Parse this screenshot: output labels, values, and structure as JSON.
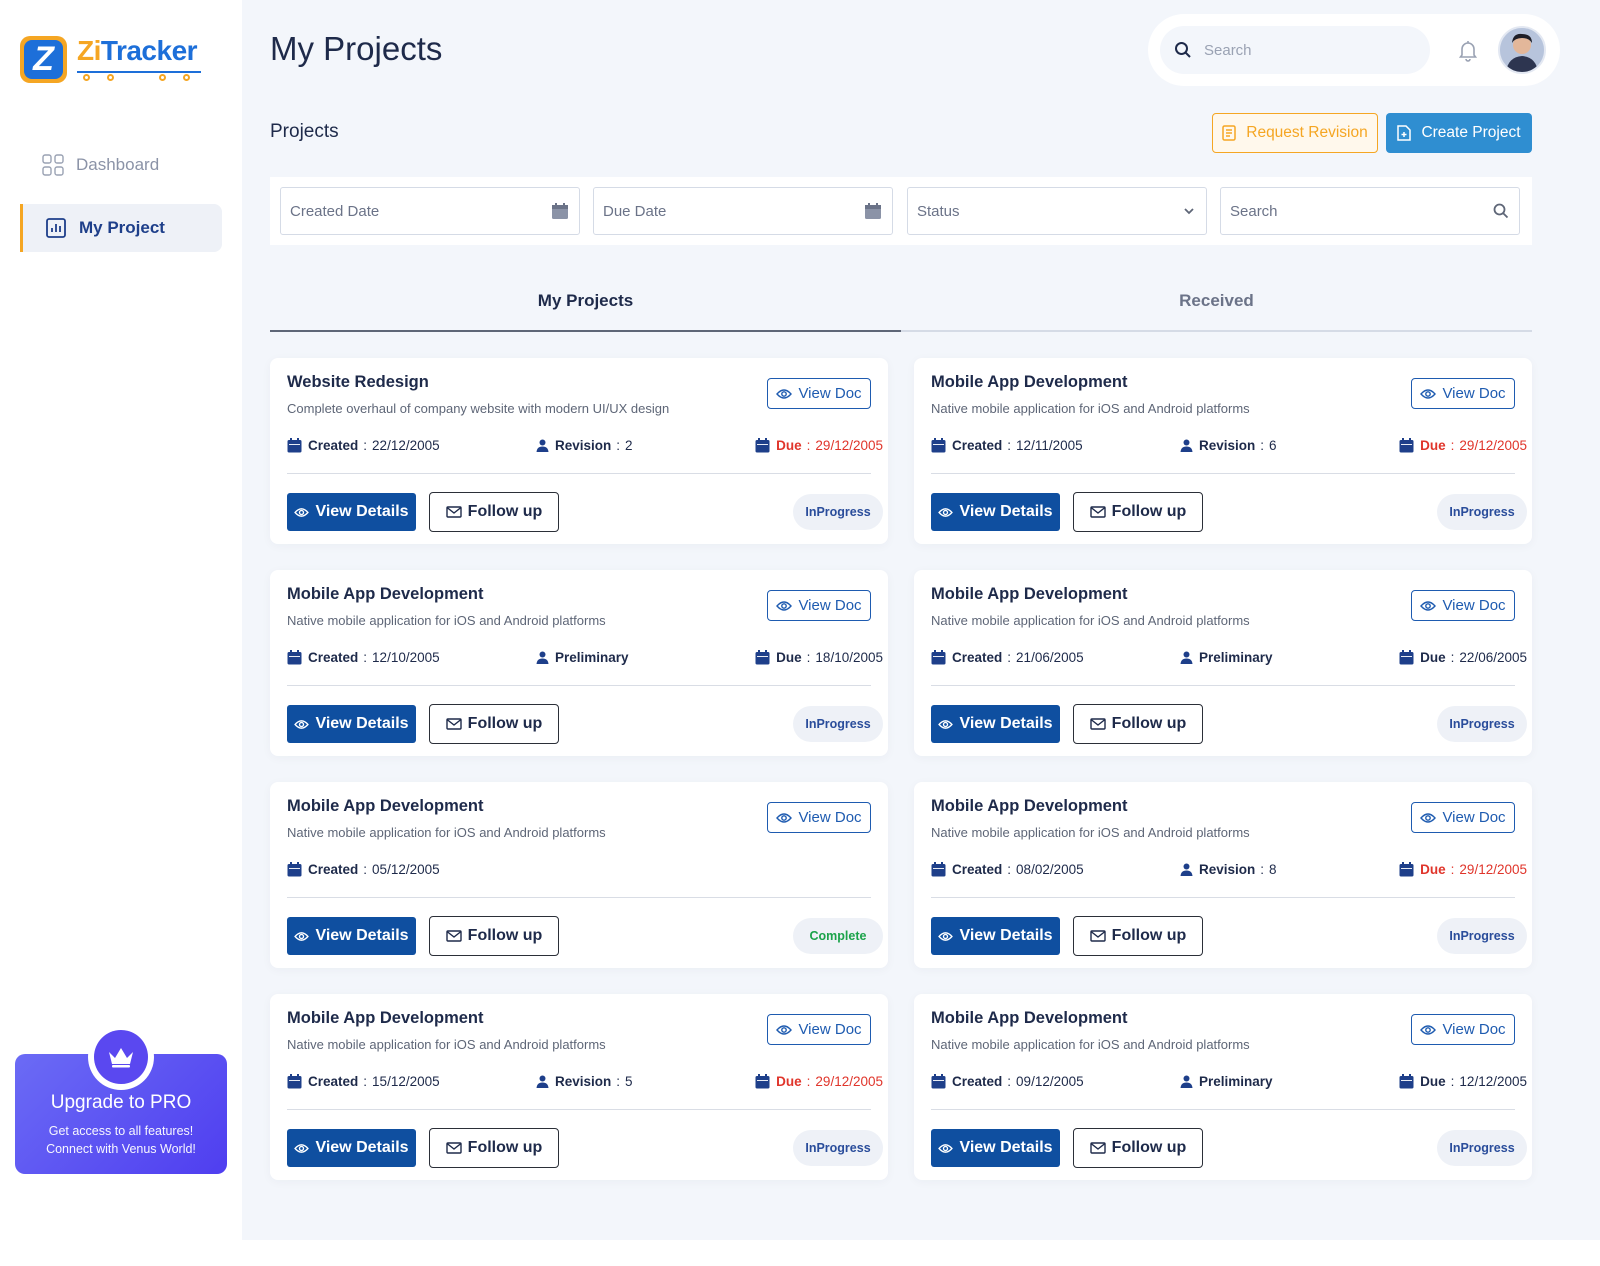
{
  "app": {
    "brand_zi": "Zi",
    "brand_tracker": "Tracker"
  },
  "sidebar": {
    "items": [
      {
        "label": "Dashboard",
        "icon": "grid-icon",
        "active": false
      },
      {
        "label": "My Project",
        "icon": "chart-icon",
        "active": true
      }
    ],
    "upgrade": {
      "title": "Upgrade to PRO",
      "line1": "Get access to all features!",
      "line2": "Connect with Venus World!"
    }
  },
  "header": {
    "title": "My Projects",
    "search_placeholder": "Search"
  },
  "section": {
    "title": "Projects",
    "request_revision": "Request Revision",
    "create_project": "Create Project"
  },
  "filters": {
    "created_date": "Created Date",
    "due_date": "Due Date",
    "status": "Status",
    "search_placeholder": "Search"
  },
  "tabs": [
    {
      "label": "My Projects",
      "active": true
    },
    {
      "label": "Received",
      "active": false
    }
  ],
  "labels": {
    "view_doc": "View Doc",
    "view_details": "View Details",
    "follow_up": "Follow up",
    "created": "Created",
    "revision": "Revision",
    "preliminary": "Preliminary",
    "due": "Due"
  },
  "colors": {
    "primary": "#0f4fa0",
    "accent": "#f5a623",
    "create": "#2f8ed1",
    "overdue": "#e0352b",
    "complete": "#1ba34a"
  },
  "projects": [
    {
      "title": "Website Redesign",
      "desc": "Complete overhaul of company website with modern UI/UX design",
      "created": "22/12/2005",
      "mid_type": "revision",
      "revision": "2",
      "due": "29/12/2005",
      "due_red": true,
      "status": "InProgress"
    },
    {
      "title": "Mobile App Development",
      "desc": "Native mobile application for iOS and Android platforms",
      "created": "12/11/2005",
      "mid_type": "revision",
      "revision": "6",
      "due": "29/12/2005",
      "due_red": true,
      "status": "InProgress"
    },
    {
      "title": "Mobile App Development",
      "desc": "Native mobile application for iOS and Android platforms",
      "created": "12/10/2005",
      "mid_type": "preliminary",
      "revision": "",
      "due": "18/10/2005",
      "due_red": false,
      "status": "InProgress"
    },
    {
      "title": "Mobile App Development",
      "desc": "Native mobile application for iOS and Android platforms",
      "created": "21/06/2005",
      "mid_type": "preliminary",
      "revision": "",
      "due": "22/06/2005",
      "due_red": false,
      "status": "InProgress"
    },
    {
      "title": "Mobile App Development",
      "desc": "Native mobile application for iOS and Android platforms",
      "created": "05/12/2005",
      "mid_type": "none",
      "revision": "",
      "due": "",
      "due_red": false,
      "status": "Complete"
    },
    {
      "title": "Mobile App Development",
      "desc": "Native mobile application for iOS and Android platforms",
      "created": "08/02/2005",
      "mid_type": "revision",
      "revision": "8",
      "due": "29/12/2005",
      "due_red": true,
      "status": "InProgress"
    },
    {
      "title": "Mobile App Development",
      "desc": "Native mobile application for iOS and Android platforms",
      "created": "15/12/2005",
      "mid_type": "revision",
      "revision": "5",
      "due": "29/12/2005",
      "due_red": true,
      "status": "InProgress"
    },
    {
      "title": "Mobile App Development",
      "desc": "Native mobile application for iOS and Android platforms",
      "created": "09/12/2005",
      "mid_type": "preliminary",
      "revision": "",
      "due": "12/12/2005",
      "due_red": false,
      "status": "InProgress"
    }
  ]
}
